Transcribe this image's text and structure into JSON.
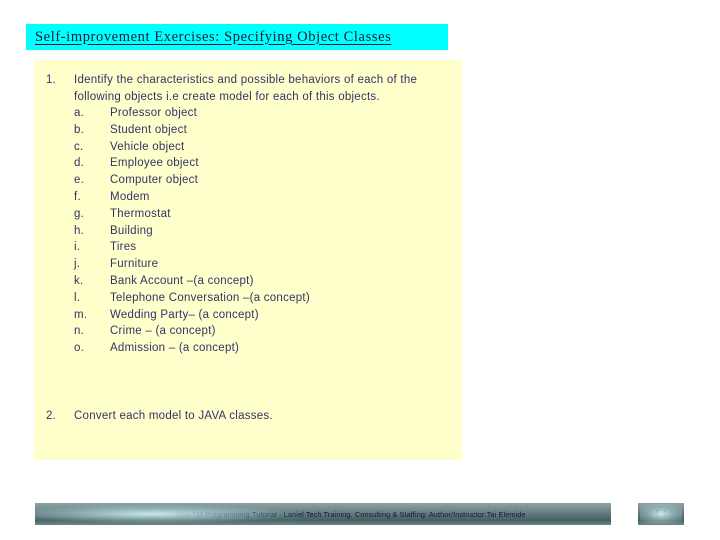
{
  "slide": {
    "title": "Self-improvement Exercises: Specifying Object Classes",
    "accent_color": "#00ffff",
    "panel_color": "#ffffcc",
    "text_color": "#333366"
  },
  "items": [
    {
      "marker": "1.",
      "text": "Identify the characteristics and possible behaviors of each of the following objects i.e create model for each of this objects."
    },
    {
      "marker": "2.",
      "text": "Convert each model to JAVA classes."
    }
  ],
  "sub_items": [
    {
      "marker": "a.",
      "label": "Professor object"
    },
    {
      "marker": "b.",
      "label": "Student object"
    },
    {
      "marker": "c.",
      "label": "Vehicle object"
    },
    {
      "marker": "d.",
      "label": "Employee object"
    },
    {
      "marker": "e.",
      "label": "Computer object"
    },
    {
      "marker": "f.",
      "label": "Modem"
    },
    {
      "marker": "g.",
      "label": "Thermostat"
    },
    {
      "marker": "h.",
      "label": "Building"
    },
    {
      "marker": "i.",
      "label": "Tires"
    },
    {
      "marker": "j.",
      "label": "Furniture"
    },
    {
      "marker": "k.",
      "label": "Bank Account –(a concept)"
    },
    {
      "marker": "l.",
      "label": "Telephone Conversation –(a concept)"
    },
    {
      "marker": "m.",
      "label": "Wedding Party– (a concept)"
    },
    {
      "marker": "n.",
      "label": "Crime – (a concept)"
    },
    {
      "marker": "o.",
      "label": "Admission – (a concept)"
    }
  ],
  "footer": {
    "text": "Java TM Programming.Tutorial - Laniel Tech Training. Consulting & Staffing: Author/Instructor:Tai Elemide",
    "page_number": "54"
  }
}
